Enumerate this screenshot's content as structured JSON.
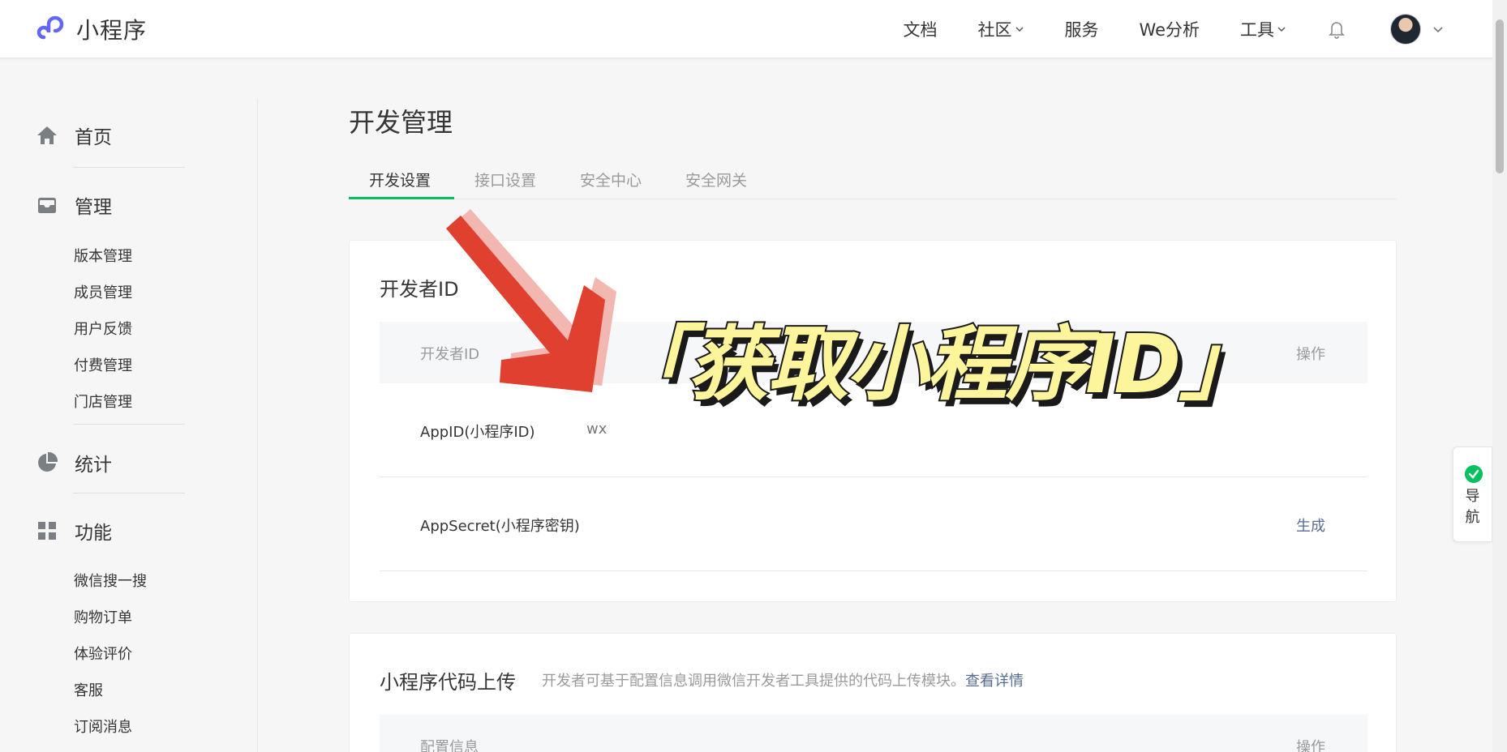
{
  "header": {
    "logo_text": "小程序",
    "nav": [
      {
        "label": "文档"
      },
      {
        "label": "社区"
      },
      {
        "label": "服务"
      },
      {
        "label": "We分析"
      },
      {
        "label": "工具"
      }
    ]
  },
  "sidebar": {
    "groups": [
      {
        "label": "首页",
        "icon": "home-icon"
      },
      {
        "label": "管理",
        "icon": "inbox-icon",
        "items": [
          "版本管理",
          "成员管理",
          "用户反馈",
          "付费管理",
          "门店管理"
        ]
      },
      {
        "label": "统计",
        "icon": "pie-chart-icon"
      },
      {
        "label": "功能",
        "icon": "grid-icon",
        "items": [
          "微信搜一搜",
          "购物订单",
          "体验评价",
          "客服",
          "订阅消息"
        ]
      }
    ]
  },
  "main": {
    "title": "开发管理",
    "tabs": [
      {
        "label": "开发设置",
        "active": true
      },
      {
        "label": "接口设置"
      },
      {
        "label": "安全中心"
      },
      {
        "label": "安全网关"
      }
    ],
    "developer_id": {
      "title": "开发者ID",
      "columns": [
        "开发者ID",
        "操作"
      ],
      "rows": [
        {
          "name": "AppID(小程序ID)",
          "value": "wx",
          "action": ""
        },
        {
          "name": "AppSecret(小程序密钥)",
          "value": "",
          "action": "生成"
        }
      ]
    },
    "code_upload": {
      "title": "小程序代码上传",
      "desc": "开发者可基于配置信息调用微信开发者工具提供的代码上传模块。",
      "desc_link": "查看详情",
      "columns": [
        "配置信息",
        "操作"
      ]
    }
  },
  "guide": {
    "label_line1": "导",
    "label_line2": "航"
  },
  "overlay": {
    "text": "「获取小程序ID」"
  },
  "colors": {
    "accent": "#07c160",
    "link": "#576b95",
    "arrow": "#e0402f",
    "overlay_text": "#fdf59b"
  }
}
